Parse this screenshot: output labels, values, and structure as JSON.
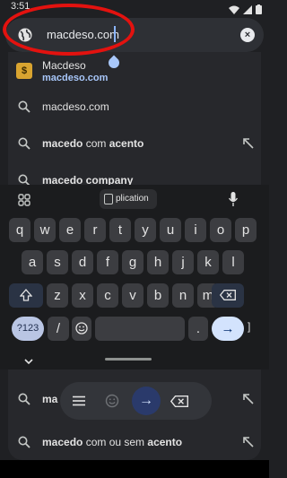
{
  "status_bar": {
    "time": "3:51"
  },
  "url_bar": {
    "value": "macdeso.com",
    "clear_symbol": "×"
  },
  "suggestions": {
    "site": {
      "title": "Macdeso",
      "url": "macdeso.com",
      "favicon": "$"
    },
    "rows": [
      {
        "plain": "macdeso.com",
        "bold": ""
      },
      {
        "plain_pre": "",
        "bold_pre": "macedo",
        "plain_mid": " com ",
        "bold_post": "acento"
      },
      {
        "text": "macedo company"
      }
    ],
    "bottom_rows": [
      {
        "text": "ma"
      },
      {
        "bold_pre": "macedo",
        "plain_mid": " com ou sem ",
        "bold_post": "acento"
      }
    ]
  },
  "keyboard": {
    "clipboard_chip": "plication",
    "row1": [
      "q",
      "w",
      "e",
      "r",
      "t",
      "y",
      "u",
      "i",
      "o",
      "p"
    ],
    "row2": [
      "a",
      "s",
      "d",
      "f",
      "g",
      "h",
      "j",
      "k",
      "l"
    ],
    "row3": [
      "z",
      "x",
      "c",
      "v",
      "b",
      "n",
      "m"
    ],
    "num_key": "?123",
    "slash_key": "/",
    "period_key": ".",
    "enter_symbol": "→",
    "right_glyph": "]"
  },
  "floating_toolbar": {
    "enter_symbol": "→"
  },
  "colors": {
    "annotation": "#e3120f",
    "url_link": "#a8c7fa",
    "enter_key": "#d3e3fd"
  }
}
